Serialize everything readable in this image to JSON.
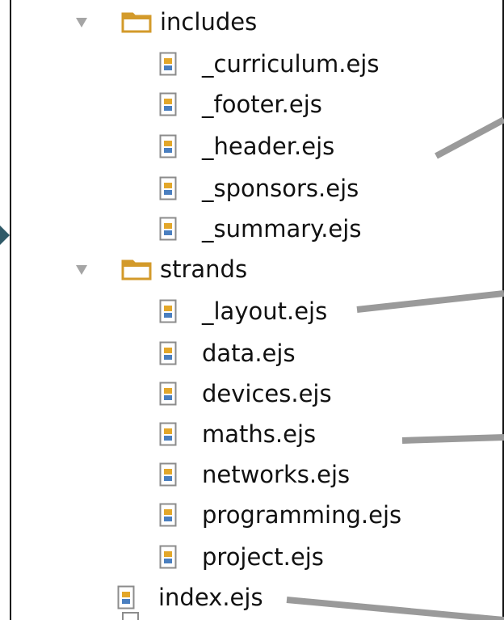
{
  "tree": {
    "folders": [
      {
        "name": "includes",
        "expanded": true,
        "files": [
          "_curriculum.ejs",
          "_footer.ejs",
          "_header.ejs",
          "_sponsors.ejs",
          "_summary.ejs"
        ]
      },
      {
        "name": "strands",
        "expanded": true,
        "files": [
          "_layout.ejs",
          "data.ejs",
          "devices.ejs",
          "maths.ejs",
          "networks.ejs",
          "programming.ejs",
          "project.ejs"
        ]
      }
    ],
    "root_files": [
      "index.ejs"
    ]
  },
  "colors": {
    "folder": "#d39a2a",
    "disclosure": "#a5a5a5",
    "leader_line": "#9a9a9a",
    "marker": "#2f5a68"
  },
  "icons": {
    "folder": "folder-icon",
    "file": "ejs-file-icon",
    "disclosure": "disclosure-triangle-icon",
    "marker": "pointer-arrow-icon"
  }
}
